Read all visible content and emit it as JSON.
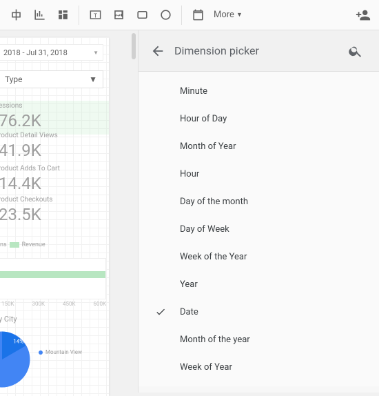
{
  "toolbar": {
    "icons": [
      "align",
      "bar-chart",
      "table",
      "text-box",
      "image",
      "rectangle",
      "circle",
      "date-range"
    ],
    "more_label": "More"
  },
  "report": {
    "date_range": "2018 - Jul 31, 2018",
    "type_label": "Type",
    "metrics": [
      {
        "label": "essions",
        "value": "76.2K"
      },
      {
        "label": "roduct Detail Views",
        "value": "41.9K"
      },
      {
        "label": "roduct Adds To Cart",
        "value": "14.4K"
      },
      {
        "label": "roduct Checkouts",
        "value": "23.5K"
      }
    ],
    "legend": {
      "label_left": "ns",
      "swatch": "Revenue"
    },
    "xaxis": [
      "150K",
      "300K",
      "450K",
      "600K"
    ],
    "city_title": "y City",
    "pie": {
      "slice_label": "14%",
      "legend_item": "Mountain View"
    }
  },
  "picker": {
    "title": "Dimension picker",
    "items": [
      {
        "label": "Minute",
        "selected": false
      },
      {
        "label": "Hour of Day",
        "selected": false
      },
      {
        "label": "Month of Year",
        "selected": false
      },
      {
        "label": "Hour",
        "selected": false
      },
      {
        "label": "Day of the month",
        "selected": false
      },
      {
        "label": "Day of Week",
        "selected": false
      },
      {
        "label": "Week of the Year",
        "selected": false
      },
      {
        "label": "Year",
        "selected": false
      },
      {
        "label": "Date",
        "selected": true
      },
      {
        "label": "Month of the year",
        "selected": false
      },
      {
        "label": "Week of Year",
        "selected": false
      }
    ]
  }
}
